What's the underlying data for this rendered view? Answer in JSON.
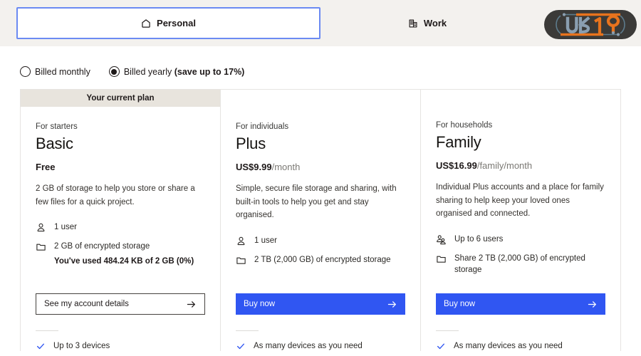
{
  "header": {
    "tabs": [
      {
        "label": "Personal",
        "icon": "home-icon",
        "active": true
      },
      {
        "label": "Work",
        "icon": "building-icon",
        "active": false
      }
    ],
    "logo": {
      "alt": "UB19",
      "text_primary": "UB",
      "text_accent": "19",
      "bg_color": "#3b3a38",
      "primary_color": "#8a9eb0",
      "accent_color": "#e8731d"
    },
    "bg_color": "#f3f1ee",
    "active_tab_border_color": "#6b8af2"
  },
  "billing": {
    "monthly": {
      "label": "Billed monthly",
      "selected": false
    },
    "yearly": {
      "label": "Billed yearly",
      "note": "(save up to 17%)",
      "selected": true
    }
  },
  "plans": [
    {
      "ribbon": "Your current plan",
      "has_ribbon": true,
      "eyebrow": "For starters",
      "name": "Basic",
      "price": "Free",
      "price_period": "",
      "blurb": "2 GB of storage to help you store or share a few files for a quick project.",
      "specs": [
        {
          "icon": "user-icon",
          "text": "1 user",
          "sub": ""
        },
        {
          "icon": "folder-icon",
          "text": "2 GB of encrypted storage",
          "sub": "You've used 484.24 KB of 2 GB (0%)"
        }
      ],
      "cta": {
        "label": "See my account details",
        "style": "outline",
        "icon": "arrow-right-icon"
      },
      "feature": {
        "icon": "check-icon",
        "text": "Up to 3 devices"
      }
    },
    {
      "ribbon": "",
      "has_ribbon": false,
      "eyebrow": "For individuals",
      "name": "Plus",
      "price": "US$9.99",
      "price_period": "/month",
      "blurb": "Simple, secure file storage and sharing, with built-in tools to help you get and stay organised.",
      "specs": [
        {
          "icon": "user-icon",
          "text": "1 user",
          "sub": ""
        },
        {
          "icon": "folder-icon",
          "text": "2 TB (2,000 GB) of encrypted storage",
          "sub": ""
        }
      ],
      "cta": {
        "label": "Buy now",
        "style": "primary",
        "icon": "arrow-right-icon"
      },
      "feature": {
        "icon": "check-icon",
        "text": "As many devices as you need"
      }
    },
    {
      "ribbon": "",
      "has_ribbon": false,
      "eyebrow": "For households",
      "name": "Family",
      "price": "US$16.99",
      "price_period": "/family/month",
      "blurb": "Individual Plus accounts and a place for family sharing to help keep your loved ones organised and connected.",
      "specs": [
        {
          "icon": "users-icon",
          "text": "Up to 6 users",
          "sub": ""
        },
        {
          "icon": "folder-icon",
          "text": "Share 2 TB (2,000 GB) of encrypted storage",
          "sub": ""
        }
      ],
      "cta": {
        "label": "Buy now",
        "style": "primary",
        "icon": "arrow-right-icon"
      },
      "feature": {
        "icon": "check-icon",
        "text": "As many devices as you need"
      }
    }
  ],
  "colors": {
    "primary_button": "#3056f2",
    "check": "#3056f2",
    "ribbon_bg": "#e8e4dd",
    "page_bg": "#ffffff"
  }
}
